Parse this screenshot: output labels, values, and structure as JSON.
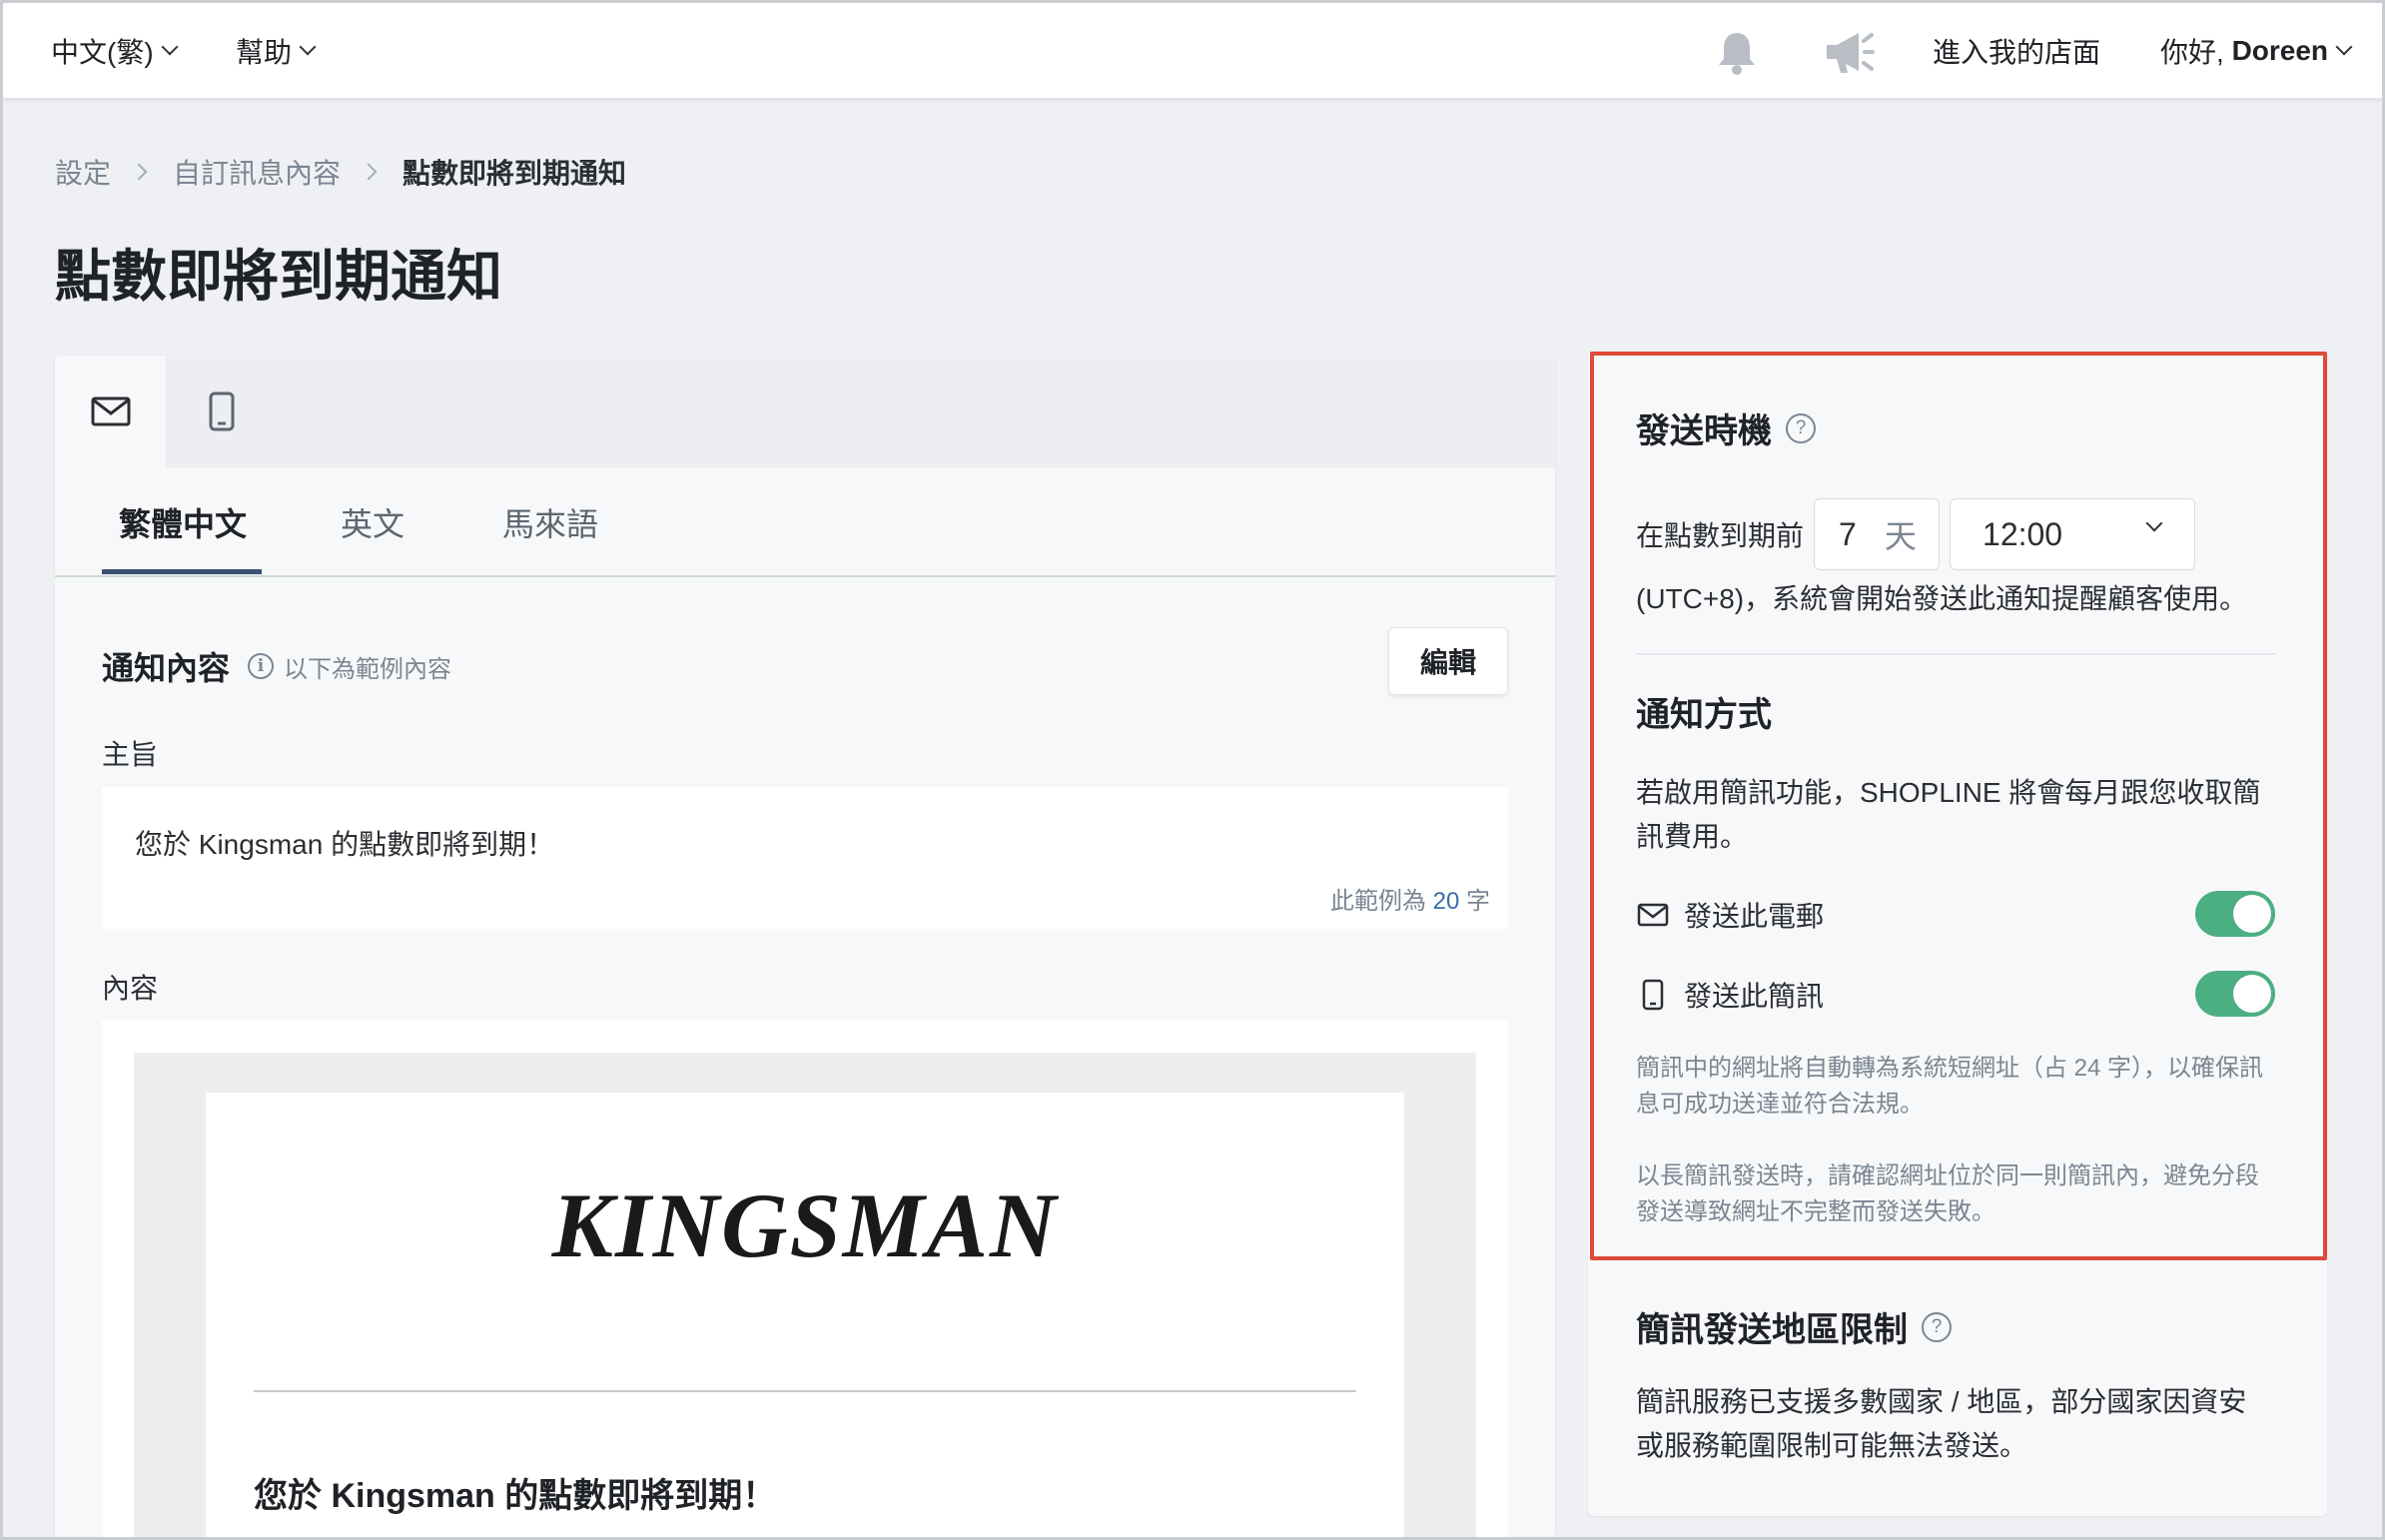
{
  "topbar": {
    "language": "中文(繁)",
    "help": "幫助",
    "enter_store": "進入我的店面",
    "greeting": "你好, ",
    "user_name": "Doreen",
    "notification_icon": "bell-icon",
    "announcement_icon": "megaphone-icon"
  },
  "breadcrumb": {
    "items": [
      "設定",
      "自訂訊息內容"
    ],
    "current": "點數即將到期通知"
  },
  "page_title": "點數即將到期通知",
  "channel_tabs": [
    {
      "icon": "email-icon",
      "active": true
    },
    {
      "icon": "mobile-icon",
      "active": false
    }
  ],
  "language_tabs": [
    {
      "label": "繁體中文",
      "active": true
    },
    {
      "label": "英文",
      "active": false
    },
    {
      "label": "馬來語",
      "active": false
    }
  ],
  "content": {
    "section_title": "通知內容",
    "section_note": "以下為範例內容",
    "edit_label": "編輯",
    "subject_label": "主旨",
    "subject_value": "您於 Kingsman 的點數即將到期！",
    "count_prefix": "此範例為",
    "count_value": "20",
    "count_suffix": "字",
    "body_label": "內容",
    "preview_logo": "KINGSMAN",
    "preview_heading": "您於 Kingsman 的點數即將到期！"
  },
  "timing": {
    "title": "發送時機",
    "prefix": "在點數到期前",
    "days_value": "7",
    "days_unit": "天",
    "time_value": "12:00",
    "suffix": "(UTC+8)，系統會開始發送此通知提醒顧客使用。"
  },
  "method": {
    "title": "通知方式",
    "description_line1": "若啟用簡訊功能，SHOPLINE 將會每月跟您收取簡",
    "description_line2": "訊費用。",
    "email_label": "發送此電郵",
    "email_enabled": true,
    "sms_label": "發送此簡訊",
    "sms_enabled": true,
    "note1_line1": "簡訊中的網址將自動轉為系統短網址（占 24 字），以確保訊",
    "note1_line2": "息可成功送達並符合法規。",
    "note2_line1": "以長簡訊發送時，請確認網址位於同一則簡訊內，避免分段",
    "note2_line2": "發送導致網址不完整而發送失敗。"
  },
  "region": {
    "title": "簡訊發送地區限制",
    "text_line1": "簡訊服務已支援多數國家 / 地區，部分國家因資安",
    "text_line2": "或服務範圍限制可能無法發送。"
  },
  "colors": {
    "toggle_on": "#4caf82",
    "highlight": "#dd4a38",
    "tab_underline": "#3a5270"
  }
}
